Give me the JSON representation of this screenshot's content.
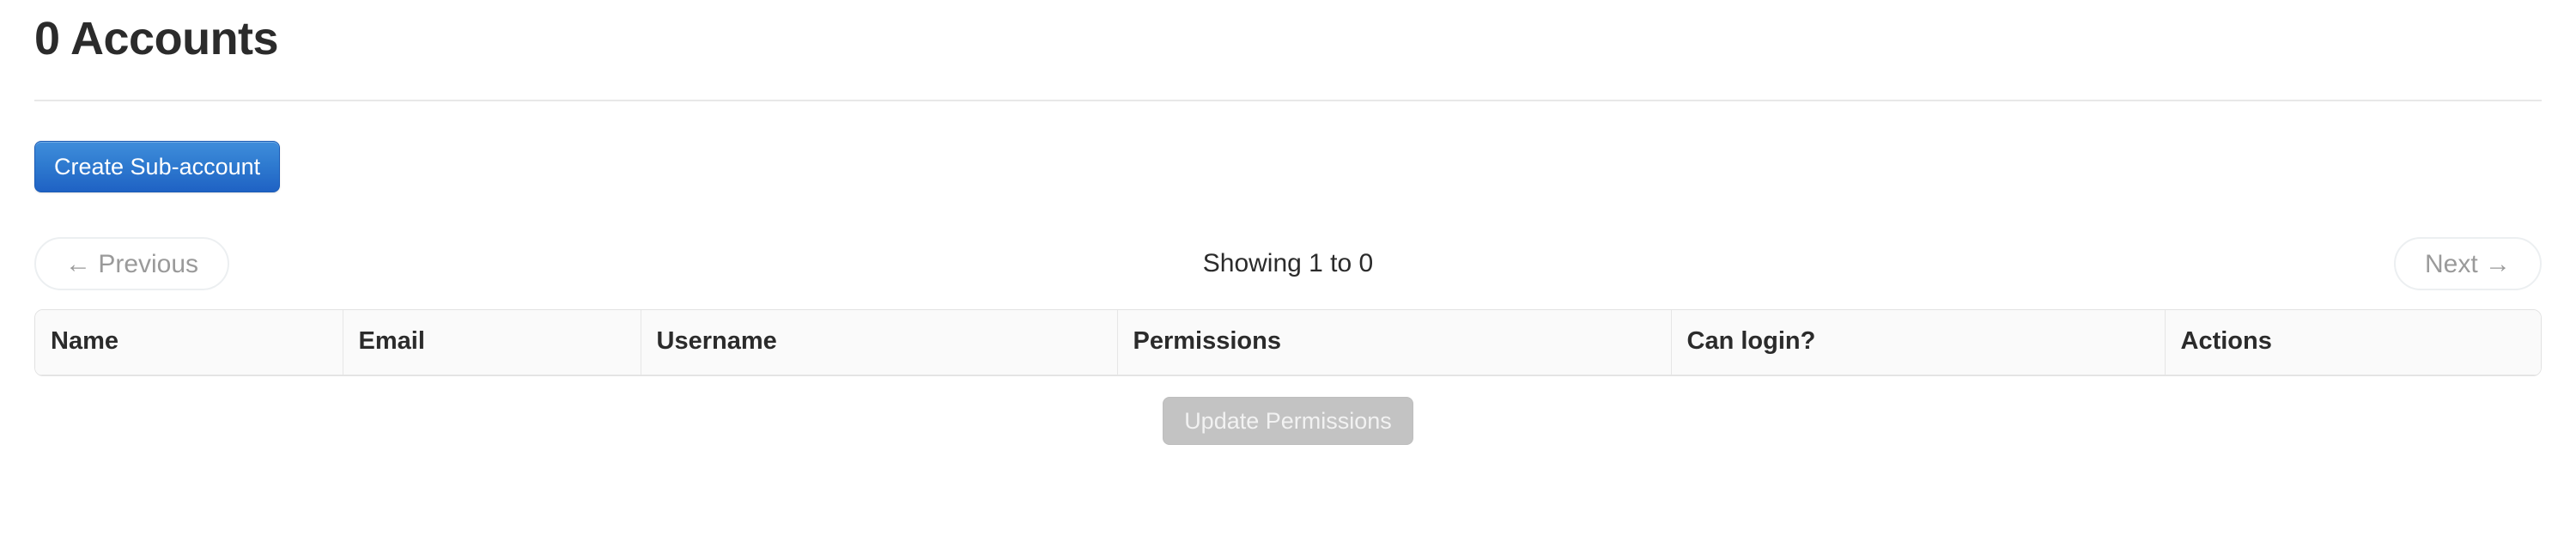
{
  "page": {
    "title": "0 Accounts"
  },
  "toolbar": {
    "create_label": "Create Sub-account"
  },
  "pagination": {
    "previous_label": "← Previous",
    "next_label": "Next →",
    "status": "Showing 1 to 0"
  },
  "table": {
    "columns": [
      {
        "key": "name",
        "label": "Name"
      },
      {
        "key": "email",
        "label": "Email"
      },
      {
        "key": "username",
        "label": "Username"
      },
      {
        "key": "permissions",
        "label": "Permissions"
      },
      {
        "key": "can_login",
        "label": "Can login?"
      },
      {
        "key": "actions",
        "label": "Actions"
      }
    ],
    "rows": []
  },
  "footer": {
    "update_permissions_label": "Update Permissions",
    "update_permissions_disabled": true
  },
  "colors": {
    "primary_button_top": "#3f8ddb",
    "primary_button_bottom": "#1f62c4",
    "disabled_button": "#c3c3c3",
    "title_text": "#2b2b2b",
    "muted_text": "#9a9a9a",
    "table_header_bg": "#fafafa",
    "border": "#e2e2e2"
  }
}
